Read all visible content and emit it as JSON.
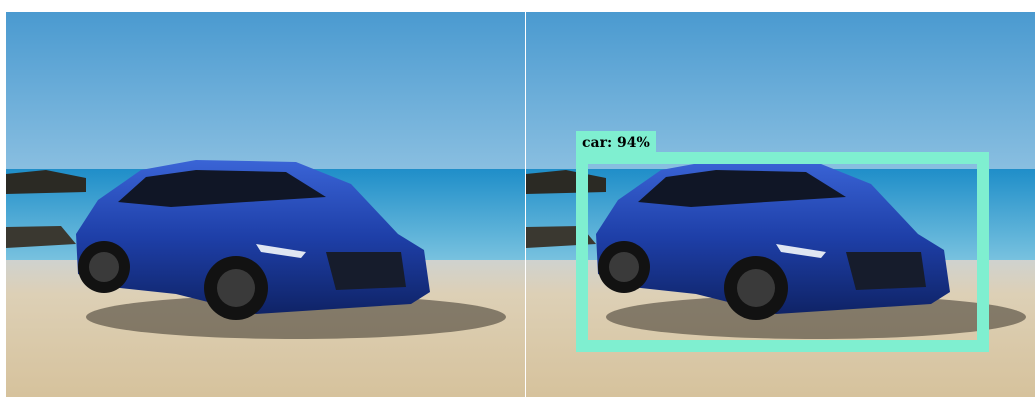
{
  "detection": {
    "label": "car:  94%",
    "class": "car",
    "confidence": 0.94,
    "box_color": "#7fefd0"
  },
  "scene": {
    "sky_top": "#4f9fd0",
    "sea": "#2f9ad0",
    "sand": "#d9c7a4",
    "car_color": "#1e3fa8"
  }
}
